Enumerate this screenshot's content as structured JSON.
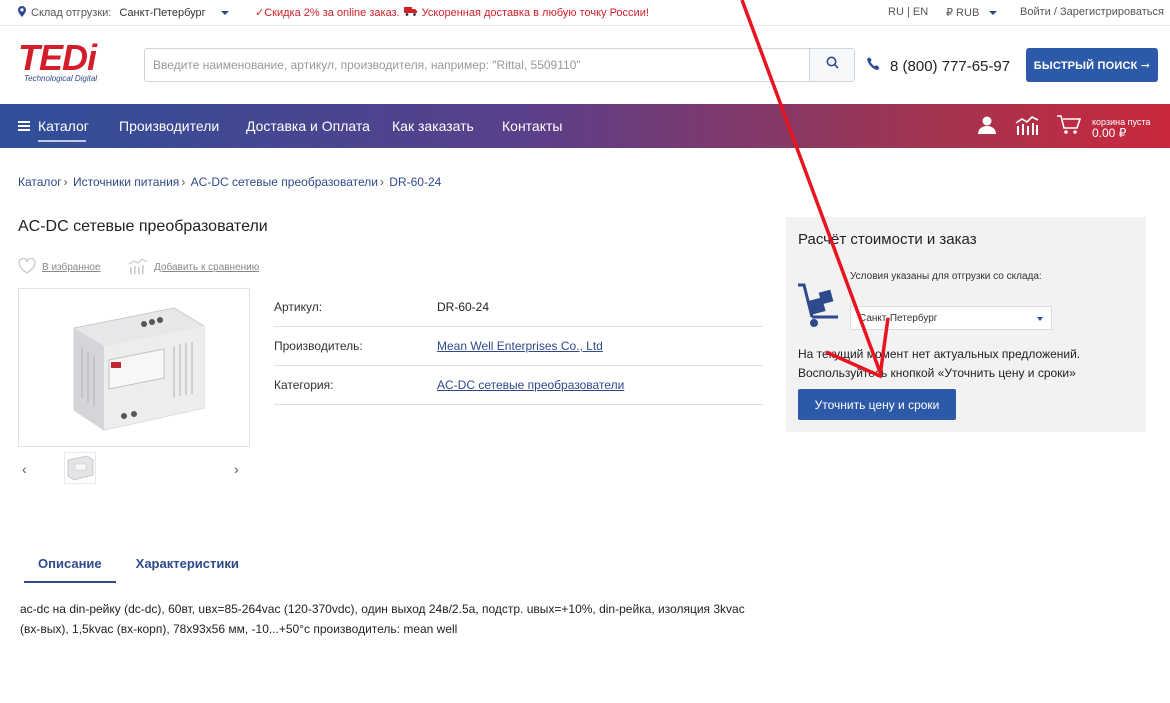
{
  "topbar": {
    "warehouse_label": "Склад отгрузки:",
    "warehouse_city": "Санкт-Петербург",
    "promo_discount": "✓Скидка 2% за online заказ.",
    "promo_delivery": "Ускоренная доставка в любую точку России!",
    "languages": "RU | EN",
    "currency": "₽ RUB",
    "login": "Войти / Зарегистрироваться"
  },
  "header": {
    "logo_word": "TEDi",
    "logo_sub": "Technological Digital",
    "search_placeholder": "Введите наименование, артикул, производителя, например: \"Rittal, 5509110\"",
    "phone": "8 (800) 777-65-97",
    "quick_search": "БЫСТРЫЙ ПОИСК ➞"
  },
  "nav": {
    "items": [
      "Каталог",
      "Производители",
      "Доставка и Оплата",
      "Как заказать",
      "Контакты"
    ],
    "cart_status": "корзина пуста",
    "cart_sum": "0.00 ₽"
  },
  "breadcrumb": [
    "Каталог",
    "Источники питания",
    "AC-DC сетевые преобразователи",
    "DR-60-24"
  ],
  "product": {
    "title": "AC-DC сетевые преобразователи",
    "favorite": "В избранное",
    "compare": "Добавить к сравнению",
    "props": [
      {
        "key": "Артикул:",
        "value": "DR-60-24"
      },
      {
        "key": "Производитель:",
        "value": "Mean Well Enterprises Co., Ltd"
      },
      {
        "key": "Категория:",
        "value": "AC-DC сетевые преобразователи"
      }
    ]
  },
  "pricebox": {
    "title": "Расчёт стоимости и заказ",
    "condition": "Условия указаны для отгрузки со склада:",
    "city": "Санкт-Петербург",
    "message": "На текущий момент нет актуальных предложений. Воспользуйтесь кнопкой «Уточнить цену и сроки»",
    "button": "Уточнить цену и сроки"
  },
  "tabs": [
    "Описание",
    "Характеристики"
  ],
  "description": "ac-dc на din-рейку (dc-dc), 60вт, uвх=85-264vac (120-370vdc), один выход 24в/2.5а, подстр. uвых=+10%, din-рейка, изоляция 3kvac (вх-вых), 1,5kvac (вх-корп), 78x93x56 мм, -10...+50°c производитель: mean well",
  "colors": {
    "accent": "#2d5aa8",
    "brand_red": "#d41d2a",
    "annotation_arrow": "#e8141f"
  }
}
